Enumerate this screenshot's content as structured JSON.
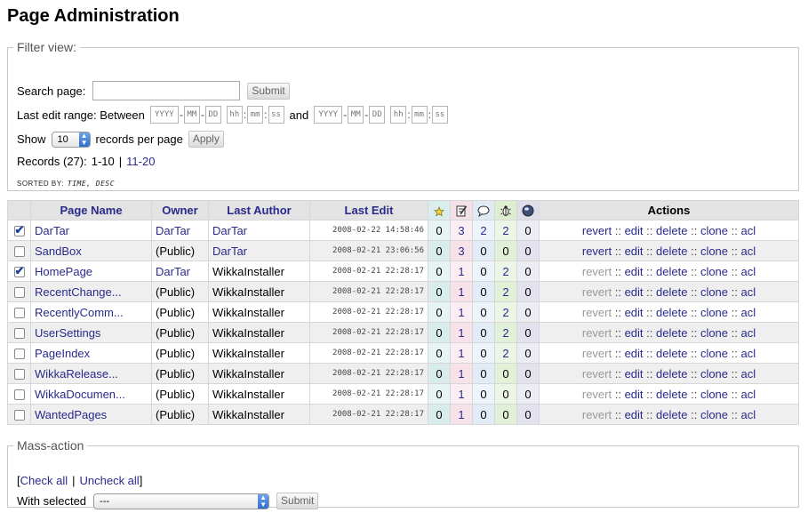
{
  "page_title": "Page Administration",
  "filter": {
    "legend": "Filter view:",
    "search_label": "Search page:",
    "search_value": "",
    "submit_label": "Submit",
    "range_label": "Last edit range: Between",
    "and_label": "and",
    "date_placeholders": {
      "yyyy": "YYYY",
      "mm": "MM",
      "dd": "DD",
      "hh": "hh",
      "min": "mm",
      "ss": "ss"
    },
    "show_label": "Show",
    "records_value": "10",
    "records_per_page": "records per page",
    "apply_label": "Apply",
    "records_label": "Records (27):",
    "page_current": "1-10",
    "page_sep": "|",
    "page_next": "11-20",
    "sorted_by_label": "SORTED BY:",
    "sorted_by_value": "TIME, DESC"
  },
  "table": {
    "headers": {
      "name": "Page Name",
      "owner": "Owner",
      "author": "Last Author",
      "edit": "Last Edit",
      "actions": "Actions"
    },
    "stat_icons": [
      "star-icon",
      "notepad-edit-icon",
      "speech-bubble-icon",
      "bug-icon",
      "globe-icon"
    ],
    "action_labels": {
      "revert": "revert",
      "edit": "edit",
      "delete": "delete",
      "clone": "clone",
      "acl": "acl",
      "sep": "::"
    },
    "rows": [
      {
        "checked": true,
        "name": "DarTar",
        "owner": "DarTar",
        "owner_link": true,
        "author": "DarTar",
        "author_link": true,
        "time": "2008-02-22 14:58:46",
        "s1": "0",
        "s2": "3",
        "s3": "2",
        "s4": "2",
        "s5": "0",
        "revert_enabled": true
      },
      {
        "checked": false,
        "name": "SandBox",
        "owner": "(Public)",
        "owner_link": false,
        "author": "DarTar",
        "author_link": true,
        "time": "2008-02-21 23:06:56",
        "s1": "0",
        "s2": "3",
        "s3": "0",
        "s4": "0",
        "s5": "0",
        "revert_enabled": true
      },
      {
        "checked": true,
        "name": "HomePage",
        "owner": "DarTar",
        "owner_link": true,
        "author": "WikkaInstaller",
        "author_link": false,
        "time": "2008-02-21 22:28:17",
        "s1": "0",
        "s2": "1",
        "s3": "0",
        "s4": "2",
        "s5": "0",
        "revert_enabled": false
      },
      {
        "checked": false,
        "name": "RecentChange...",
        "owner": "(Public)",
        "owner_link": false,
        "author": "WikkaInstaller",
        "author_link": false,
        "time": "2008-02-21 22:28:17",
        "s1": "0",
        "s2": "1",
        "s3": "0",
        "s4": "2",
        "s5": "0",
        "revert_enabled": false
      },
      {
        "checked": false,
        "name": "RecentlyComm...",
        "owner": "(Public)",
        "owner_link": false,
        "author": "WikkaInstaller",
        "author_link": false,
        "time": "2008-02-21 22:28:17",
        "s1": "0",
        "s2": "1",
        "s3": "0",
        "s4": "2",
        "s5": "0",
        "revert_enabled": false
      },
      {
        "checked": false,
        "name": "UserSettings",
        "owner": "(Public)",
        "owner_link": false,
        "author": "WikkaInstaller",
        "author_link": false,
        "time": "2008-02-21 22:28:17",
        "s1": "0",
        "s2": "1",
        "s3": "0",
        "s4": "2",
        "s5": "0",
        "revert_enabled": false
      },
      {
        "checked": false,
        "name": "PageIndex",
        "owner": "(Public)",
        "owner_link": false,
        "author": "WikkaInstaller",
        "author_link": false,
        "time": "2008-02-21 22:28:17",
        "s1": "0",
        "s2": "1",
        "s3": "0",
        "s4": "2",
        "s5": "0",
        "revert_enabled": false
      },
      {
        "checked": false,
        "name": "WikkaRelease...",
        "owner": "(Public)",
        "owner_link": false,
        "author": "WikkaInstaller",
        "author_link": false,
        "time": "2008-02-21 22:28:17",
        "s1": "0",
        "s2": "1",
        "s3": "0",
        "s4": "0",
        "s5": "0",
        "revert_enabled": false
      },
      {
        "checked": false,
        "name": "WikkaDocumen...",
        "owner": "(Public)",
        "owner_link": false,
        "author": "WikkaInstaller",
        "author_link": false,
        "time": "2008-02-21 22:28:17",
        "s1": "0",
        "s2": "1",
        "s3": "0",
        "s4": "0",
        "s5": "0",
        "revert_enabled": false
      },
      {
        "checked": false,
        "name": "WantedPages",
        "owner": "(Public)",
        "owner_link": false,
        "author": "WikkaInstaller",
        "author_link": false,
        "time": "2008-02-21 22:28:17",
        "s1": "0",
        "s2": "1",
        "s3": "0",
        "s4": "0",
        "s5": "0",
        "revert_enabled": false
      }
    ]
  },
  "mass": {
    "legend": "Mass-action",
    "open_bracket": "[",
    "check_all": "Check all",
    "sep": "|",
    "uncheck_all": "Uncheck all",
    "close_bracket": "]",
    "with_selected": "With selected",
    "select_value": "---",
    "submit_label": "Submit"
  }
}
